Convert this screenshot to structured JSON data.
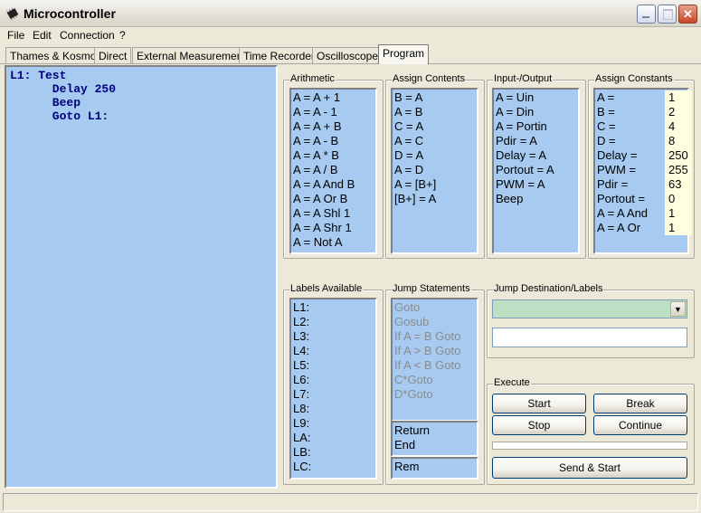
{
  "window": {
    "title": "Microcontroller"
  },
  "menu": [
    "File",
    "Edit",
    "Connection",
    "?"
  ],
  "tabs": [
    "Thames & Kosmos",
    "Direct",
    "External Measurement",
    "Time Recorder",
    "Oscilloscope",
    "Program"
  ],
  "active_tab": "Program",
  "program_lines": [
    "L1: Test",
    "      Delay 250",
    "      Beep",
    "      Goto L1:"
  ],
  "arithmetic": {
    "caption": "Arithmetic",
    "items": [
      "A = A + 1",
      "A = A - 1",
      "A = A + B",
      "A = A - B",
      "A = A * B",
      "A = A / B",
      "A = A And B",
      "A = A Or B",
      "A = A Shl 1",
      "A = A Shr 1",
      "A = Not A"
    ]
  },
  "assign_contents": {
    "caption": "Assign Contents",
    "items": [
      "B = A",
      "A = B",
      "C = A",
      "A = C",
      "D = A",
      "A = D",
      "A = [B+]",
      "[B+] = A"
    ]
  },
  "io": {
    "caption": "Input-/Output",
    "items": [
      "A = Uin",
      "A = Din",
      "A = Portin",
      "Pdir = A",
      "Delay = A",
      "Portout = A",
      "PWM = A",
      "Beep"
    ]
  },
  "constants": {
    "caption": "Assign Constants",
    "items": [
      {
        "label": "A =",
        "value": "1"
      },
      {
        "label": "B =",
        "value": "2"
      },
      {
        "label": "C =",
        "value": "4"
      },
      {
        "label": "D =",
        "value": "8"
      },
      {
        "label": "Delay =",
        "value": "250"
      },
      {
        "label": "PWM =",
        "value": "255"
      },
      {
        "label": "Pdir =",
        "value": "63"
      },
      {
        "label": "Portout =",
        "value": "0"
      },
      {
        "label": "A = A And",
        "value": "1"
      },
      {
        "label": "A = A Or",
        "value": "1"
      }
    ]
  },
  "labels": {
    "caption": "Labels Available",
    "items": [
      "L1:",
      "L2:",
      "L3:",
      "L4:",
      "L5:",
      "L6:",
      "L7:",
      "L8:",
      "L9:",
      "LA:",
      "LB:",
      "LC:"
    ]
  },
  "jumps": {
    "caption": "Jump Statements",
    "items": [
      "Goto",
      "Gosub",
      "If A = B Goto",
      "If A > B Goto",
      "If A < B Goto",
      "C*Goto",
      "D*Goto"
    ],
    "returns": [
      "Return",
      "End"
    ],
    "rem": [
      "Rem"
    ]
  },
  "jump_dest": {
    "caption": "Jump Destination/Labels",
    "combo_value": "",
    "text_value": ""
  },
  "execute": {
    "caption": "Execute",
    "start": "Start",
    "break": "Break",
    "stop": "Stop",
    "continue": "Continue",
    "send_start": "Send & Start",
    "progress": 0
  },
  "colors": {
    "list_bg": "#A6CAF0",
    "editor_text": "#000080",
    "combo_bg": "#BDE0C4",
    "const_bg": "#FFFFE0"
  },
  "status_text": ""
}
